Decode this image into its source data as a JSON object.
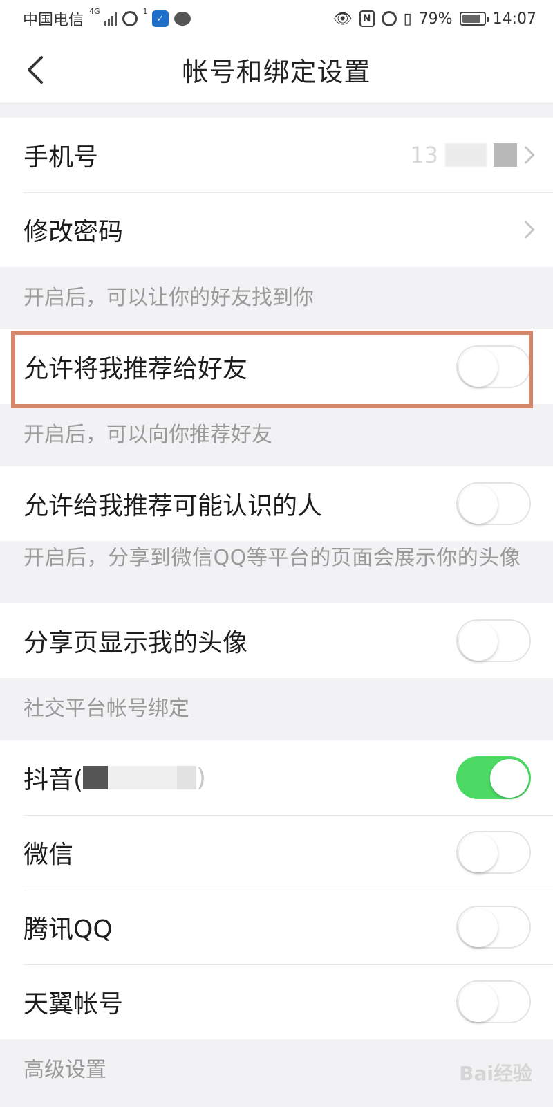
{
  "status_bar": {
    "carrier": "中国电信",
    "network": "4G",
    "hotspot_count": "1",
    "battery": "79%",
    "time": "14:07"
  },
  "header": {
    "title": "帐号和绑定设置"
  },
  "account": {
    "phone_label": "手机号",
    "phone_value_prefix": "13",
    "password_label": "修改密码"
  },
  "notes": {
    "find_me": "开启后，可以让你的好友找到你",
    "recommend_to_me": "开启后，可以向你推荐好友",
    "share_avatar": "开启后，分享到微信QQ等平台的页面会展示你的头像",
    "social_binding": "社交平台帐号绑定",
    "advanced": "高级设置"
  },
  "privacy": {
    "recommend_me_label": "允许将我推荐给好友",
    "recommend_me_on": false,
    "recommend_people_label": "允许给我推荐可能认识的人",
    "recommend_people_on": false,
    "share_avatar_label": "分享页显示我的头像",
    "share_avatar_on": false
  },
  "social": [
    {
      "label": "抖音(",
      "suffix": ")",
      "on": true
    },
    {
      "label": "微信",
      "on": false
    },
    {
      "label": "腾讯QQ",
      "on": false
    },
    {
      "label": "天翼帐号",
      "on": false
    }
  ],
  "watermark": "Bai经验",
  "colors": {
    "toggle_on": "#4cd964",
    "highlight": "#d4876b"
  }
}
